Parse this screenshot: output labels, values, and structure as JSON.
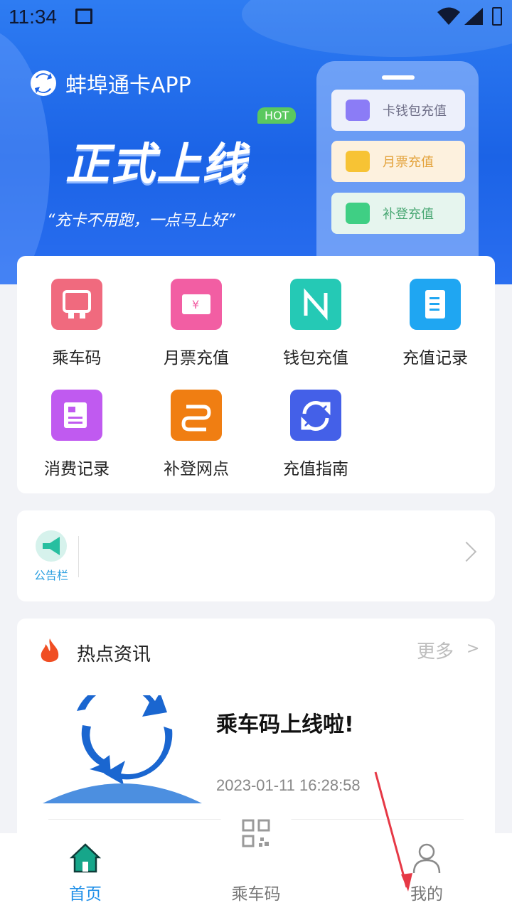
{
  "status_bar": {
    "time": "11:34"
  },
  "banner": {
    "app_name": "蚌埠通卡APP",
    "slogan_big": "正式上线",
    "hot_badge": "HOT",
    "slogan_small": "“充卡不用跑，一点马上好”",
    "phone_items": [
      {
        "label": "卡钱包充值",
        "color": "#8b7cf6",
        "bg": "#edf0fb",
        "text_color": "#6f6f88"
      },
      {
        "label": "月票充值",
        "color": "#f7c334",
        "bg": "#fdf1de",
        "text_color": "#e3a23a"
      },
      {
        "label": "补登充值",
        "color": "#3fcf84",
        "bg": "#e6f5ee",
        "text_color": "#4aa874"
      }
    ]
  },
  "functions": [
    {
      "label": "乘车码",
      "icon": "bus-code-icon",
      "color": "#f06a7e"
    },
    {
      "label": "月票充值",
      "icon": "ticket-icon",
      "color": "#f25ea3"
    },
    {
      "label": "钱包充值",
      "icon": "nfc-icon",
      "color": "#25c9b5"
    },
    {
      "label": "充值记录",
      "icon": "document-icon",
      "color": "#1fa6f2"
    },
    {
      "label": "消费记录",
      "icon": "news-icon",
      "color": "#c05af0"
    },
    {
      "label": "补登网点",
      "icon": "route-icon",
      "color": "#f07e12"
    },
    {
      "label": "充值指南",
      "icon": "refresh-icon",
      "color": "#4460e8"
    }
  ],
  "notice": {
    "label": "公告栏"
  },
  "news": {
    "title": "热点资讯",
    "more": "更多",
    "more_arrow": ">",
    "items": [
      {
        "headline": "乘车码上线啦!",
        "time": "2023-01-11 16:28:58"
      }
    ]
  },
  "bottom_nav": {
    "items": [
      {
        "label": "首页",
        "active": true
      },
      {
        "label": "乘车码",
        "active": false
      },
      {
        "label": "我的",
        "active": false
      }
    ],
    "active_color": "#1f8fe8",
    "inactive_color": "#777777"
  }
}
